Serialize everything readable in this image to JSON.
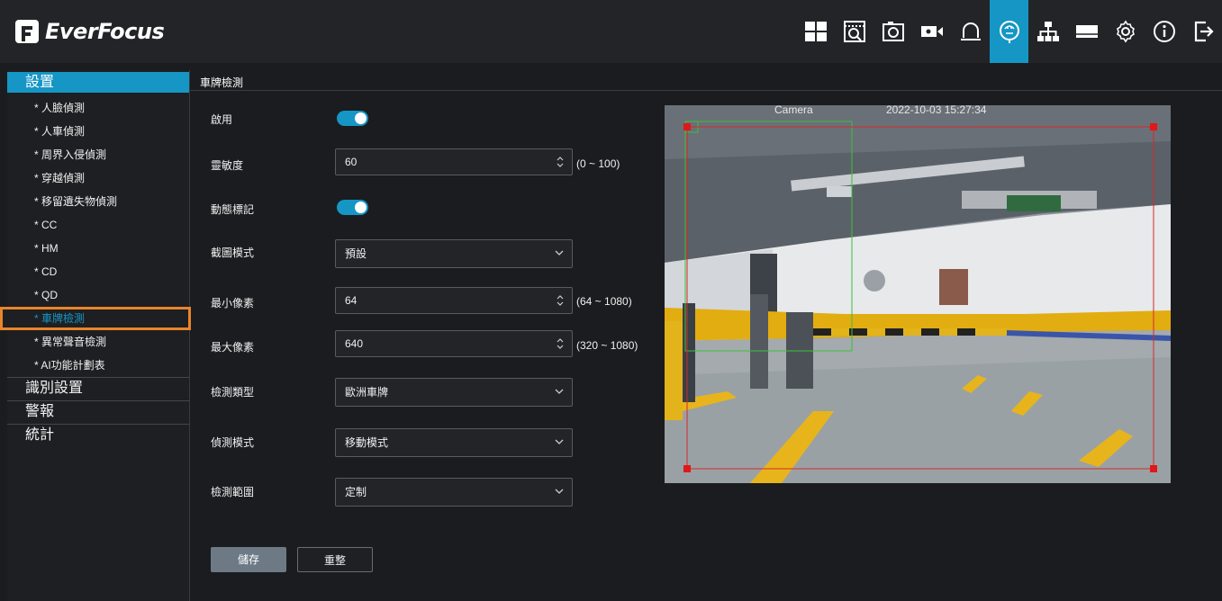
{
  "app": {
    "brand": "EverFocus"
  },
  "top_icons": [
    {
      "name": "layout-icon",
      "active": false
    },
    {
      "name": "playback-icon",
      "active": false
    },
    {
      "name": "snapshot-icon",
      "active": false
    },
    {
      "name": "record-icon",
      "active": false
    },
    {
      "name": "alarm-icon",
      "active": false
    },
    {
      "name": "ai-icon",
      "active": true
    },
    {
      "name": "network-icon",
      "active": false
    },
    {
      "name": "storage-icon",
      "active": false
    },
    {
      "name": "settings-icon",
      "active": false
    },
    {
      "name": "info-icon",
      "active": false
    },
    {
      "name": "logout-icon",
      "active": false
    }
  ],
  "sidebar": {
    "header": "設置",
    "items": [
      {
        "label": "* 人臉偵測"
      },
      {
        "label": "* 人車偵測"
      },
      {
        "label": "* 周界入侵偵測"
      },
      {
        "label": "* 穿越偵測"
      },
      {
        "label": "* 移留遺失物偵測"
      },
      {
        "label": "* CC"
      },
      {
        "label": "* HM"
      },
      {
        "label": "* CD"
      },
      {
        "label": "* QD"
      },
      {
        "label": "* 車牌檢測"
      },
      {
        "label": "* 異常聲音檢測"
      },
      {
        "label": "* AI功能計劃表"
      }
    ],
    "selected_index": 9,
    "sections": [
      {
        "label": "識別設置"
      },
      {
        "label": "警報"
      },
      {
        "label": "統計"
      }
    ]
  },
  "panel": {
    "title": "車牌檢測",
    "fields": {
      "enable": {
        "label": "啟用",
        "on": true
      },
      "sensitivity": {
        "label": "靈敏度",
        "value": "60",
        "range": "(0 ~ 100)"
      },
      "dynamic_mark": {
        "label": "動態標記",
        "on": true
      },
      "crop_mode": {
        "label": "截圖模式",
        "value": "預設"
      },
      "min_pixel": {
        "label": "最小像素",
        "value": "64",
        "range": "(64 ~ 1080)"
      },
      "max_pixel": {
        "label": "最大像素",
        "value": "640",
        "range": "(320 ~ 1080)"
      },
      "detect_type": {
        "label": "檢測類型",
        "value": "歐洲車牌"
      },
      "detect_mode": {
        "label": "偵測模式",
        "value": "移動模式"
      },
      "detect_range": {
        "label": "檢測範圍",
        "value": "定制"
      }
    },
    "buttons": {
      "save": "儲存",
      "reset": "重整"
    }
  },
  "preview": {
    "osd_title": "Camera",
    "osd_time": "2022-10-03 15:27:34"
  },
  "colors": {
    "accent": "#1596c5",
    "selection_outline": "#e8852b",
    "detection_area": "#d42a2a",
    "min_box": "#3cc13c"
  }
}
